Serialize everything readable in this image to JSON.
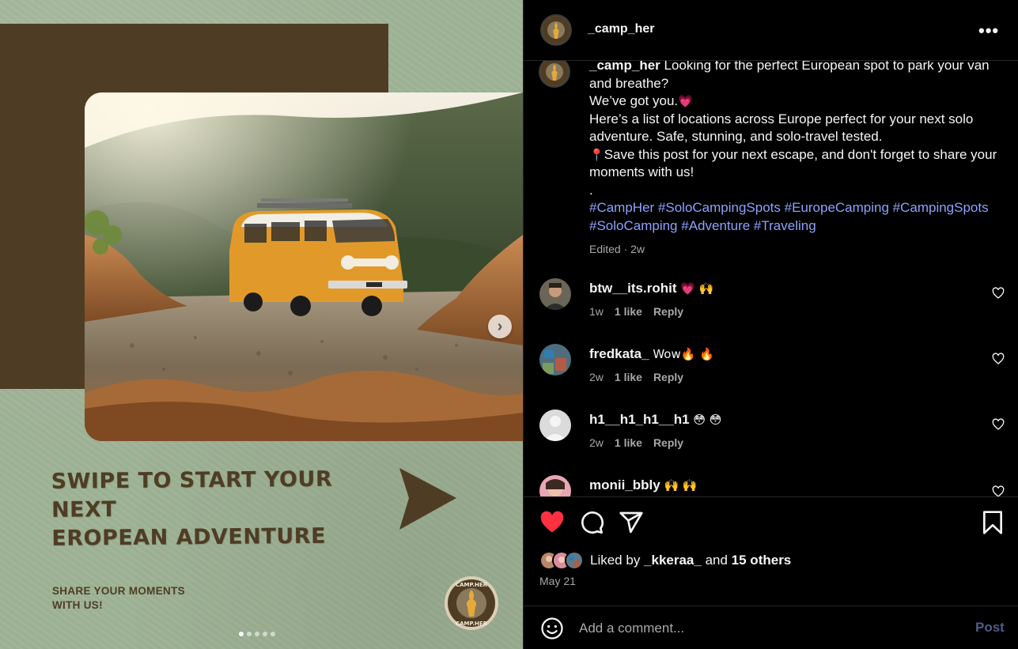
{
  "post_image": {
    "headline_line1": "SWIPE TO START YOUR NEXT",
    "headline_line2": "EROPEAN ADVENTURE",
    "share_line1": "SHARE YOUR MOMENTS",
    "share_line2": "WITH US!",
    "badge_top": "CAMP.HER",
    "badge_bottom": "CAMP.HER",
    "next_glyph": "›",
    "carousel_total": 5,
    "carousel_index": 1,
    "colors": {
      "background": "#9fb396",
      "brown": "#4e3d24",
      "van": "#e19a2a"
    }
  },
  "header": {
    "username": "_camp_her",
    "more_glyph": "•••"
  },
  "caption": {
    "author": "_camp_her",
    "line1": "Looking for the perfect European spot to park your van and breathe?",
    "line2": "We’ve got you.",
    "line2_emoji": "💗",
    "line3": "Here’s a list of locations across Europe perfect for your next solo adventure. Safe, stunning, and solo-travel tested.",
    "line4_emoji": "📍",
    "line4": "Save this post for your next escape, and don't forget to share your moments with us!",
    "line5": ".",
    "hashtags": "#CampHer #SoloCampingSpots #EuropeCamping #CampingSpots #SoloCamping #Adventure #Traveling",
    "meta": "Edited · 2w"
  },
  "comments": [
    {
      "user": "btw__its.rohit",
      "text": "💗 🙌",
      "age": "1w",
      "likes": "1 like",
      "reply": "Reply"
    },
    {
      "user": "fredkata_",
      "text": "Wow🔥 🔥",
      "age": "2w",
      "likes": "1 like",
      "reply": "Reply"
    },
    {
      "user": "h1__h1_h1__h1",
      "text": "😳 😳",
      "age": "2w",
      "likes": "1 like",
      "reply": "Reply"
    },
    {
      "user": "monii_bbly",
      "text": "🙌 🙌",
      "age": "",
      "likes": "",
      "reply": ""
    }
  ],
  "likes": {
    "prefix": "Liked by ",
    "user": "_kkeraa_",
    "mid": " and ",
    "others": "15 others"
  },
  "date": "May 21",
  "add_comment": {
    "placeholder": "Add a comment...",
    "post_label": "Post"
  },
  "icons": [
    "heart-icon",
    "comment-icon",
    "share-icon",
    "bookmark-icon",
    "emoji-icon",
    "more-icon"
  ],
  "accent_colors": {
    "like_red": "#ff3040",
    "hashtag_blue": "#8ea1ff",
    "muted": "#a8a8a8"
  }
}
